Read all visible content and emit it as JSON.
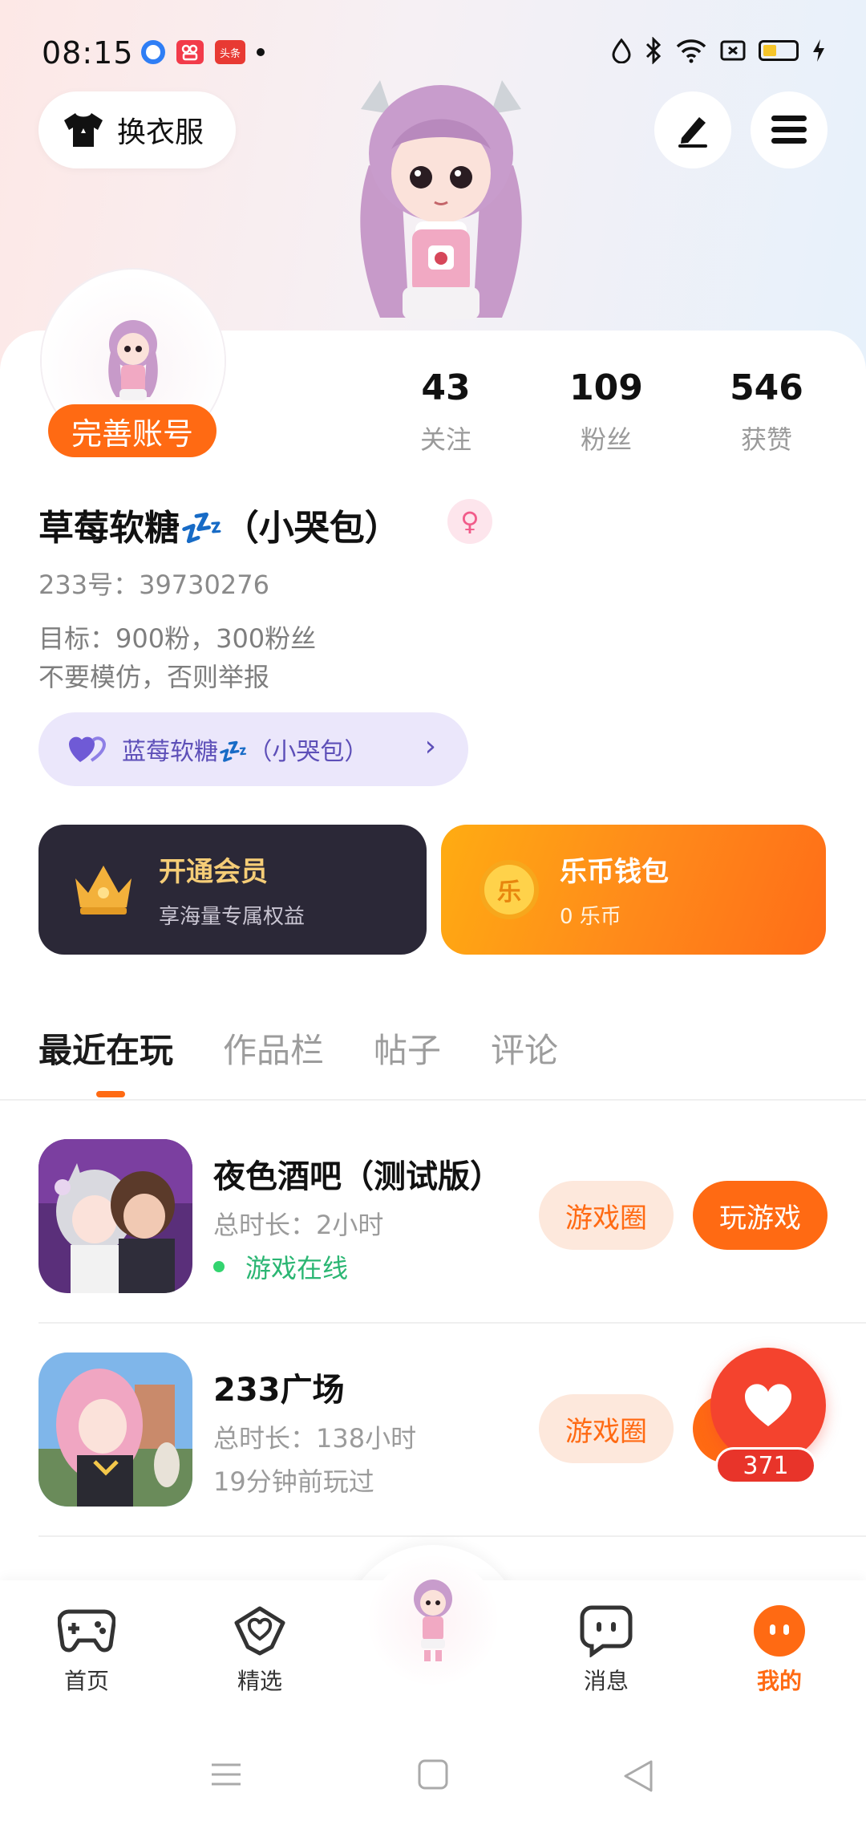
{
  "status_bar": {
    "time": "08:15",
    "app_icons": [
      "browser-icon",
      "kuaishou-icon",
      "toutiao-icon"
    ],
    "toutiao_label": "头条"
  },
  "header": {
    "dressup_label": "换衣服",
    "edit_icon": "pencil-icon",
    "menu_icon": "hamburger-icon"
  },
  "profile": {
    "complete_label": "完善账号",
    "stats": [
      {
        "value": "43",
        "label": "关注"
      },
      {
        "value": "109",
        "label": "粉丝"
      },
      {
        "value": "546",
        "label": "获赞"
      }
    ],
    "username": "草莓软糖💤（小哭包）",
    "user_id": "233号：39730276",
    "bio_line1": "目标：900粉，300粉丝",
    "bio_line2": "不要模仿，否则举报",
    "linked_account": "蓝莓软糖💤（小哭包）"
  },
  "cards": {
    "vip_title": "开通会员",
    "vip_sub": "享海量专属权益",
    "wallet_title": "乐币钱包",
    "wallet_sub": "0 乐币",
    "coin_glyph": "乐"
  },
  "tabs": [
    "最近在玩",
    "作品栏",
    "帖子",
    "评论"
  ],
  "games": [
    {
      "name": "夜色酒吧（测试版）",
      "duration": "总时长：2小时",
      "status": "游戏在线",
      "circle_label": "游戏圈",
      "play_label": "玩游戏"
    },
    {
      "name": "233广场",
      "duration": "总时长：138小时",
      "status": "19分钟前玩过",
      "circle_label": "游戏圈"
    }
  ],
  "like": {
    "count": "371"
  },
  "bottom_nav": [
    {
      "label": "首页",
      "icon": "gamepad-icon"
    },
    {
      "label": "精选",
      "icon": "heart-chat-icon"
    },
    {
      "label": "消息",
      "icon": "message-icon"
    },
    {
      "label": "我的",
      "icon": "profile-face-icon"
    }
  ],
  "colors": {
    "accent": "#ff6a13",
    "vip_bg": "#2b2837",
    "online": "#2bb673",
    "like": "#f4432e"
  }
}
